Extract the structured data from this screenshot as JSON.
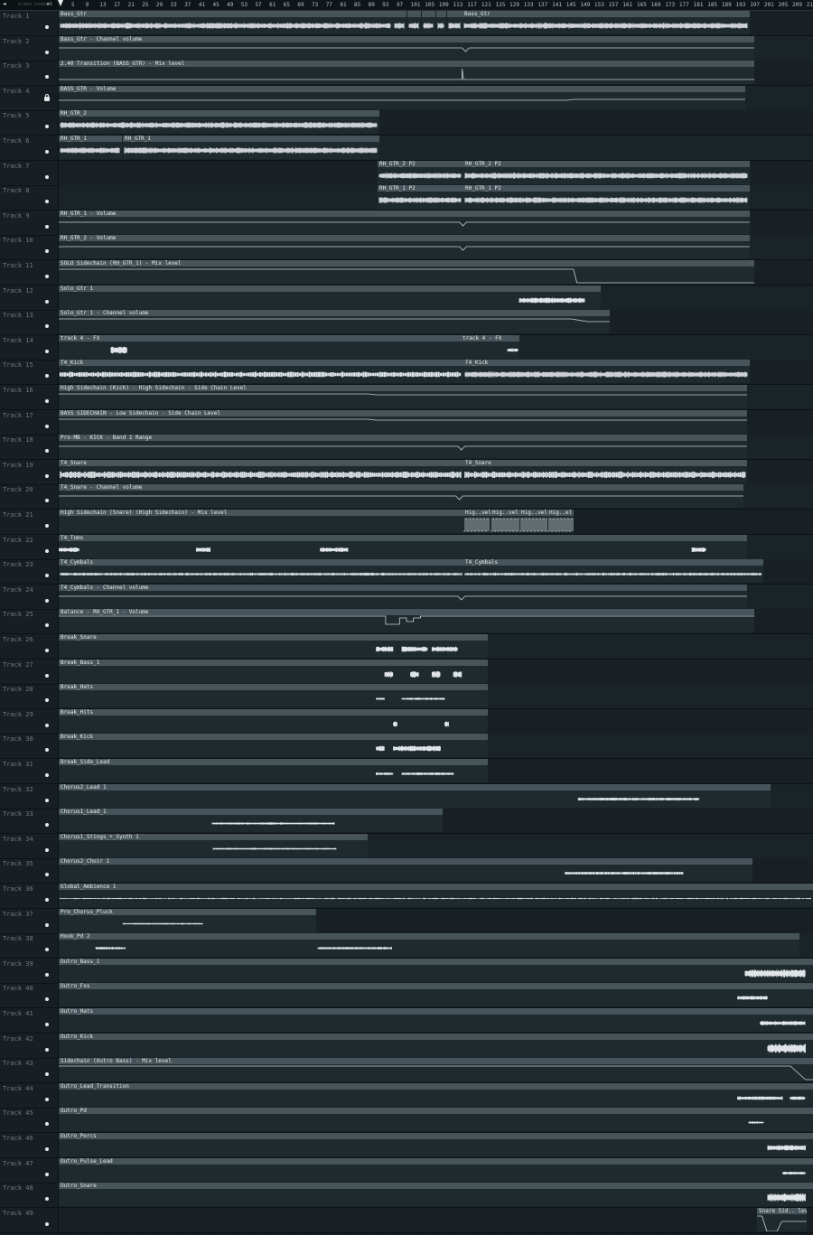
{
  "ruler": {
    "corner_a": "◄",
    "corner_b": "x:xxx  xxxxx",
    "corner_c": "ml",
    "bars": [
      "5",
      "9",
      "13",
      "17",
      "21",
      "25",
      "29",
      "33",
      "37",
      "41",
      "45",
      "49",
      "53",
      "57",
      "61",
      "65",
      "69",
      "73",
      "77",
      "81",
      "85",
      "89",
      "93",
      "97",
      "101",
      "105",
      "109",
      "113",
      "117",
      "121",
      "125",
      "129",
      "133",
      "137",
      "141",
      "145",
      "149",
      "153",
      "157",
      "161",
      "165",
      "169",
      "173",
      "177",
      "181",
      "185",
      "189",
      "193",
      "197",
      "201",
      "205",
      "209",
      "21"
    ]
  },
  "tracks": [
    {
      "name": "Track 1",
      "clips": [
        {
          "t": "Bass_Gtr",
          "s": 0,
          "e": 370,
          "k": "dense"
        },
        {
          "t": "",
          "s": 370,
          "e": 385,
          "k": "dense"
        },
        {
          "t": "",
          "s": 386,
          "e": 401,
          "k": "dense"
        },
        {
          "t": "",
          "s": 402,
          "e": 417,
          "k": "dense"
        },
        {
          "t": "",
          "s": 418,
          "e": 429,
          "k": "dense"
        },
        {
          "t": "",
          "s": 430,
          "e": 447,
          "k": "dense"
        },
        {
          "t": "Bass_Gtr",
          "s": 447,
          "e": 765,
          "k": "dense"
        }
      ]
    },
    {
      "name": "Track 2",
      "clips": [
        {
          "t": "Bass_Gtr - Channel volume",
          "s": 0,
          "e": 770,
          "k": "auto-dip"
        }
      ]
    },
    {
      "name": "Track 3",
      "clips": [
        {
          "t": "2.40 Transition (BASS_GTR) - Mix level",
          "s": 0,
          "e": 770,
          "k": "auto-spike"
        }
      ]
    },
    {
      "name": "Track 4",
      "lock": true,
      "clips": [
        {
          "t": "BASS_GTR - Volume",
          "s": 0,
          "e": 760,
          "k": "auto-step"
        }
      ]
    },
    {
      "name": "Track 5",
      "clips": [
        {
          "t": "RH_GTR_2",
          "s": 0,
          "e": 355,
          "k": "dense"
        }
      ]
    },
    {
      "name": "Track 6",
      "clips": [
        {
          "t": "RH_GTR_1",
          "s": 0,
          "e": 70,
          "k": "dense"
        },
        {
          "t": "RH_GTR_1",
          "s": 71,
          "e": 355,
          "k": "dense"
        }
      ]
    },
    {
      "name": "Track 7",
      "clips": [
        {
          "t": "RH_GTR_2 P2",
          "s": 353,
          "e": 448,
          "k": "dense"
        },
        {
          "t": "RH_GTR_2 P2",
          "s": 448,
          "e": 765,
          "k": "dense"
        }
      ]
    },
    {
      "name": "Track 8",
      "clips": [
        {
          "t": "RH_GTR_1 P2",
          "s": 353,
          "e": 448,
          "k": "dense"
        },
        {
          "t": "RH_GTR_1 P2",
          "s": 448,
          "e": 765,
          "k": "dense"
        }
      ]
    },
    {
      "name": "Track 9",
      "clips": [
        {
          "t": "RH_GTR_1 - Volume",
          "s": 0,
          "e": 765,
          "k": "auto-dip"
        }
      ]
    },
    {
      "name": "Track 10",
      "clips": [
        {
          "t": "RH_GTR_2 - Volume",
          "s": 0,
          "e": 765,
          "k": "auto-dip"
        }
      ]
    },
    {
      "name": "Track 11",
      "clips": [
        {
          "t": "SOLO Sidechain (RH_GTR_1) - Mix level",
          "s": 0,
          "e": 770,
          "k": "auto-drop"
        }
      ]
    },
    {
      "name": "Track 12",
      "clips": [
        {
          "t": "Solo_Gtr 1",
          "s": 0,
          "e": 600,
          "k": "solo"
        }
      ]
    },
    {
      "name": "Track 13",
      "clips": [
        {
          "t": "Solo_Gtr 1 - Channel volume",
          "s": 0,
          "e": 610,
          "k": "auto-tail"
        }
      ]
    },
    {
      "name": "Track 14",
      "clips": [
        {
          "t": "track 4 - FX",
          "s": 0,
          "e": 445,
          "k": "fx1"
        },
        {
          "t": "track 4 - FX",
          "s": 445,
          "e": 510,
          "k": "fx2"
        }
      ]
    },
    {
      "name": "Track 15",
      "clips": [
        {
          "t": "T4_Kick",
          "s": 0,
          "e": 448,
          "k": "kick"
        },
        {
          "t": "T4_Kick",
          "s": 448,
          "e": 765,
          "k": "dense"
        }
      ]
    },
    {
      "name": "Track 16",
      "clips": [
        {
          "t": "High Sidechain (Kick) - High Sidechain - Side Chain Level",
          "s": 0,
          "e": 762,
          "k": "auto-low"
        }
      ]
    },
    {
      "name": "Track 17",
      "clips": [
        {
          "t": "BASS SIDECHAIN - Low Sidechain - Side Chain Level",
          "s": 0,
          "e": 762,
          "k": "auto-low"
        }
      ]
    },
    {
      "name": "Track 18",
      "clips": [
        {
          "t": "Pro-MB - KICK - Band 1 Range",
          "s": 0,
          "e": 762,
          "k": "auto-dip"
        }
      ]
    },
    {
      "name": "Track 19",
      "clips": [
        {
          "t": "T4_Snare",
          "s": 0,
          "e": 448,
          "k": "snare"
        },
        {
          "t": "T4_Snare",
          "s": 448,
          "e": 762,
          "k": "snare"
        }
      ]
    },
    {
      "name": "Track 20",
      "clips": [
        {
          "t": "T4_Snare - Channel volume",
          "s": 0,
          "e": 758,
          "k": "auto-dip"
        }
      ]
    },
    {
      "name": "Track 21",
      "clips": [
        {
          "t": "High Sidechain (Snare) (High Sidechain) - Mix level",
          "s": 0,
          "e": 448,
          "k": "flat"
        },
        {
          "t": "Hig..vel",
          "s": 448,
          "e": 478,
          "k": "pulse"
        },
        {
          "t": "Hig..vel",
          "s": 478,
          "e": 510,
          "k": "pulse"
        },
        {
          "t": "Hig..vel",
          "s": 510,
          "e": 541,
          "k": "pulse"
        },
        {
          "t": "Hig..el",
          "s": 541,
          "e": 570,
          "k": "pulse"
        }
      ]
    },
    {
      "name": "Track 22",
      "clips": [
        {
          "t": "T4_Toms",
          "s": 0,
          "e": 762,
          "k": "toms"
        }
      ]
    },
    {
      "name": "Track 23",
      "clips": [
        {
          "t": "T4_Cymbals",
          "s": 0,
          "e": 448,
          "k": "cym"
        },
        {
          "t": "T4_Cymbals",
          "s": 448,
          "e": 780,
          "k": "cym"
        }
      ]
    },
    {
      "name": "Track 24",
      "clips": [
        {
          "t": "T4_Cymbals - Channel volume",
          "s": 0,
          "e": 762,
          "k": "auto-dip"
        }
      ]
    },
    {
      "name": "Track 25",
      "clips": [
        {
          "t": "Balance - RH_GTR_1 - Volume",
          "s": 0,
          "e": 770,
          "k": "auto-bal"
        }
      ]
    },
    {
      "name": "Track 26",
      "clips": [
        {
          "t": "Break_Snare",
          "s": 0,
          "e": 475,
          "k": "brk1"
        }
      ]
    },
    {
      "name": "Track 27",
      "clips": [
        {
          "t": "Break_Bass_1",
          "s": 0,
          "e": 475,
          "k": "brk2"
        }
      ]
    },
    {
      "name": "Track 28",
      "clips": [
        {
          "t": "Break_Hats",
          "s": 0,
          "e": 475,
          "k": "brk3"
        }
      ]
    },
    {
      "name": "Track 29",
      "clips": [
        {
          "t": "Break_Hits",
          "s": 0,
          "e": 475,
          "k": "brk4"
        }
      ]
    },
    {
      "name": "Track 30",
      "clips": [
        {
          "t": "Break_Kick",
          "s": 0,
          "e": 475,
          "k": "brk5"
        }
      ]
    },
    {
      "name": "Track 31",
      "clips": [
        {
          "t": "Break_Side_Lead",
          "s": 0,
          "e": 475,
          "k": "brk6"
        }
      ]
    },
    {
      "name": "Track 32",
      "clips": [
        {
          "t": "Chorus2_Lead 1",
          "s": 0,
          "e": 788,
          "k": "ch2"
        }
      ]
    },
    {
      "name": "Track 33",
      "clips": [
        {
          "t": "Chorus1_Lead_1",
          "s": 0,
          "e": 425,
          "k": "ch1"
        }
      ]
    },
    {
      "name": "Track 34",
      "clips": [
        {
          "t": "Chorus1_Stings_+_Synth 1",
          "s": 0,
          "e": 342,
          "k": "ch1b"
        }
      ]
    },
    {
      "name": "Track 35",
      "clips": [
        {
          "t": "Chorus2_Choir 1",
          "s": 0,
          "e": 768,
          "k": "ch2"
        }
      ]
    },
    {
      "name": "Track 36",
      "clips": [
        {
          "t": "Global_Ambience 1",
          "s": 0,
          "e": 835,
          "k": "amb"
        }
      ]
    },
    {
      "name": "Track 37",
      "clips": [
        {
          "t": "Pre_Chorus_Pluck",
          "s": 0,
          "e": 285,
          "k": "pluck"
        }
      ]
    },
    {
      "name": "Track 38",
      "clips": [
        {
          "t": "Hook_Pd 2",
          "s": 0,
          "e": 820,
          "k": "hook"
        }
      ]
    },
    {
      "name": "Track 39",
      "clips": [
        {
          "t": "Outro_Bass_1",
          "s": 0,
          "e": 835,
          "k": "ob"
        }
      ]
    },
    {
      "name": "Track 40",
      "clips": [
        {
          "t": "Outro_Fxs",
          "s": 0,
          "e": 835,
          "k": "ofx"
        }
      ]
    },
    {
      "name": "Track 41",
      "clips": [
        {
          "t": "Outro_Hats",
          "s": 0,
          "e": 835,
          "k": "ohat"
        }
      ]
    },
    {
      "name": "Track 42",
      "clips": [
        {
          "t": "Outro_Kick",
          "s": 0,
          "e": 835,
          "k": "okick"
        }
      ]
    },
    {
      "name": "Track 43",
      "clips": [
        {
          "t": "Sidechain (Outro Bass) - Mix level",
          "s": 0,
          "e": 835,
          "k": "auto-end"
        }
      ]
    },
    {
      "name": "Track 44",
      "clips": [
        {
          "t": "Outro_Lead_Transition",
          "s": 0,
          "e": 835,
          "k": "olt"
        }
      ]
    },
    {
      "name": "Track 45",
      "clips": [
        {
          "t": "Outro_Pd",
          "s": 0,
          "e": 835,
          "k": "opd"
        }
      ]
    },
    {
      "name": "Track 46",
      "clips": [
        {
          "t": "Outro_Percs",
          "s": 0,
          "e": 835,
          "k": "operc"
        }
      ]
    },
    {
      "name": "Track 47",
      "clips": [
        {
          "t": "Outro_Pulse_Lead",
          "s": 0,
          "e": 835,
          "k": "opl"
        }
      ]
    },
    {
      "name": "Track 48",
      "clips": [
        {
          "t": "Outro_Snare",
          "s": 0,
          "e": 835,
          "k": "osn"
        }
      ]
    },
    {
      "name": "Track 49",
      "clips": [
        {
          "t": "",
          "s": 0,
          "e": 772,
          "k": "empty"
        },
        {
          "t": "Snare Sid.. level",
          "s": 773,
          "e": 828,
          "k": "auto-v"
        }
      ]
    }
  ]
}
